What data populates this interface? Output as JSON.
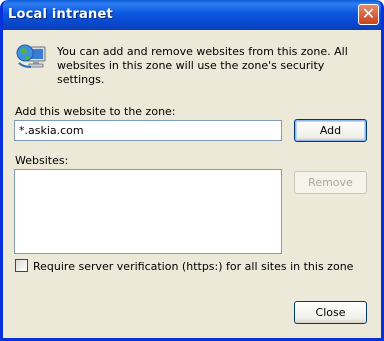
{
  "window": {
    "title": "Local intranet",
    "close_symbol": "✕"
  },
  "info": {
    "text": "You can add and remove websites from this zone. All websites in this zone will use the zone's security settings."
  },
  "add": {
    "label": "Add this website to the zone:",
    "value": "*.askia.com",
    "button": "Add"
  },
  "websites": {
    "label": "Websites:",
    "items": [],
    "remove_button": "Remove"
  },
  "verify": {
    "label": "Require server verification (https:) for all sites in this zone",
    "checked": false
  },
  "footer": {
    "close_button": "Close"
  },
  "colors": {
    "titlebar": "#0b58e0",
    "dialog_bg": "#ece9d8",
    "close_button": "#d5532b",
    "input_border": "#7f9db9"
  }
}
